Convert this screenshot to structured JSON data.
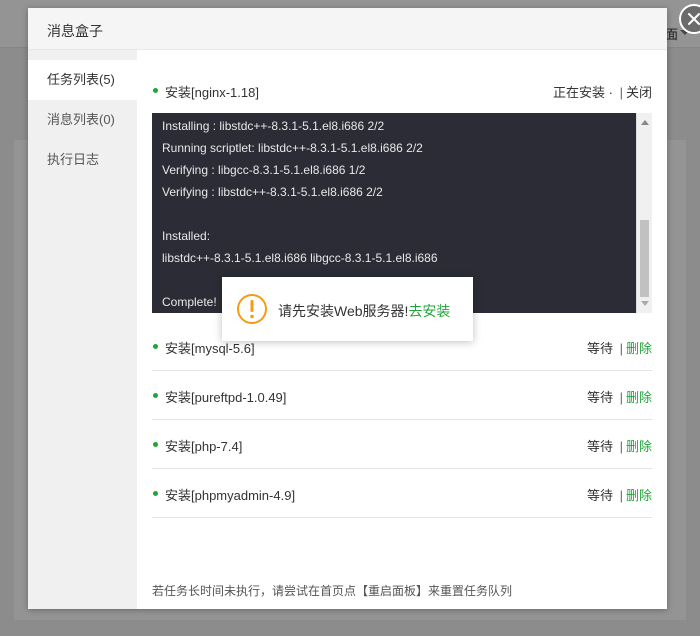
{
  "background": {
    "top_text": "面"
  },
  "dialog": {
    "title": "消息盒子"
  },
  "sidebar": {
    "items": [
      {
        "label": "任务列表(5)"
      },
      {
        "label": "消息列表(0)"
      },
      {
        "label": "执行日志"
      }
    ]
  },
  "current_task": {
    "name": "安装[nginx-1.18]",
    "status": "正在安装 ·",
    "separator": "|",
    "close_label": "关闭"
  },
  "log": {
    "lines": [
      "Installing : libstdc++-8.3.1-5.1.el8.i686 2/2",
      "Running scriptlet: libstdc++-8.3.1-5.1.el8.i686 2/2",
      "Verifying : libgcc-8.3.1-5.1.el8.i686 1/2",
      "Verifying : libstdc++-8.3.1-5.1.el8.i686 2/2",
      "Installed:",
      "libstdc++-8.3.1-5.1.el8.i686 libgcc-8.3.1-5.1.el8.i686",
      "Complete!"
    ]
  },
  "queued_tasks": [
    {
      "name": "安装[mysql-5.6]",
      "status": "等待",
      "separator": "|",
      "action": "删除"
    },
    {
      "name": "安装[pureftpd-1.0.49]",
      "status": "等待",
      "separator": "|",
      "action": "删除"
    },
    {
      "name": "安装[php-7.4]",
      "status": "等待",
      "separator": "|",
      "action": "删除"
    },
    {
      "name": "安装[phpmyadmin-4.9]",
      "status": "等待",
      "separator": "|",
      "action": "删除"
    }
  ],
  "footer_note": "若任务长时间未执行，请尝试在首页点【重启面板】来重置任务队列",
  "alert": {
    "message": "请先安装Web服务器!",
    "link": "去安装"
  },
  "colors": {
    "accent": "#20a53a",
    "log_bg": "#2b2c35",
    "warning": "#f39c12"
  }
}
